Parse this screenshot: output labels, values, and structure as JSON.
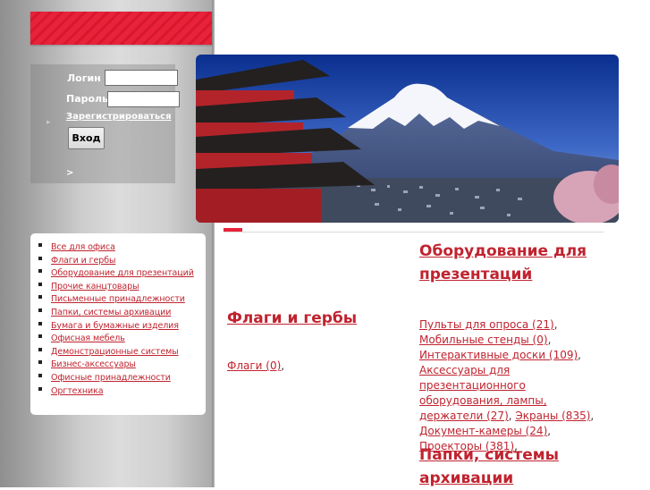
{
  "login": {
    "login_label": "Логин",
    "password_label": "Пароль",
    "register_link": "Зарегистрироваться",
    "submit_label": "Вход",
    "more_link": ">",
    "arrow_glyph": "▸"
  },
  "nav": {
    "items": [
      {
        "label": "Все для офиса"
      },
      {
        "label": "Флаги и гербы"
      },
      {
        "label": "Оборудование для презентаций"
      },
      {
        "label": "Прочие канцтовары"
      },
      {
        "label": "Письменные принадлежности"
      },
      {
        "label": "Папки, системы архивации"
      },
      {
        "label": "Бумага и бумажные изделия"
      },
      {
        "label": "Офисная мебель"
      },
      {
        "label": "Демонстрационные системы"
      },
      {
        "label": "Бизнес-аксессуары"
      },
      {
        "label": "Офисные принадлежности"
      },
      {
        "label": "Оргтехника"
      }
    ]
  },
  "catalog": {
    "flags": {
      "title": "Флаги и гербы",
      "subs": [
        {
          "label": "Флаги (0)"
        }
      ]
    },
    "presentation": {
      "title": "Оборудование для презентаций",
      "subs": [
        {
          "label": "Пульты для опроса (21)"
        },
        {
          "label": "Мобильные стенды (0)"
        },
        {
          "label": "Интерактивные доски (109)"
        },
        {
          "label": "Аксессуары для презентационного оборудования, лампы, держатели (27)"
        },
        {
          "label": "Экраны (835)"
        },
        {
          "label": "Документ-камеры (24)"
        },
        {
          "label": "Проекторы (381)"
        }
      ]
    },
    "folders": {
      "title": "Папки, системы архивации"
    }
  },
  "colors": {
    "accent_red": "#e8223a",
    "link_red": "#c0232f",
    "sidebar_gray": "#c8c8c8"
  }
}
